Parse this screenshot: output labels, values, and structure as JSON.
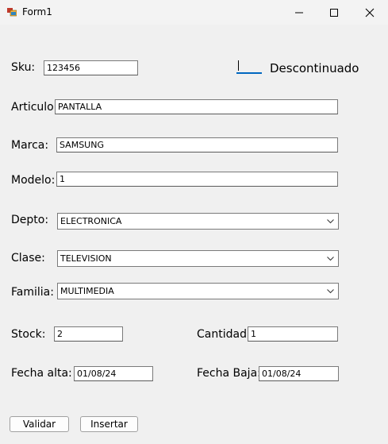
{
  "window": {
    "title": "Form1"
  },
  "colors": {
    "accent": "#0067c0",
    "background": "#f0f0f0"
  },
  "form": {
    "sku": {
      "label": "Sku:",
      "value": "123456"
    },
    "descontinuado": {
      "label": "Descontinuado",
      "checked": false
    },
    "articulo": {
      "label": "Articulo:",
      "value": "PANTALLA"
    },
    "marca": {
      "label": "Marca:",
      "value": "SAMSUNG"
    },
    "modelo": {
      "label": "Modelo:",
      "value": "1"
    },
    "depto": {
      "label": "Depto:",
      "selected": "ELECTRONICA"
    },
    "clase": {
      "label": "Clase:",
      "selected": "TELEVISION"
    },
    "familia": {
      "label": "Familia:",
      "selected": "MULTIMEDIA"
    },
    "stock": {
      "label": "Stock:",
      "value": "2"
    },
    "cantidad": {
      "label": "Cantidad:",
      "value": "1"
    },
    "fecha_alta": {
      "label": "Fecha alta:",
      "value": "01/08/24"
    },
    "fecha_baja": {
      "label": "Fecha Baja:",
      "value": "01/08/24"
    }
  },
  "buttons": {
    "validar": "Validar",
    "insertar": "Insertar"
  }
}
